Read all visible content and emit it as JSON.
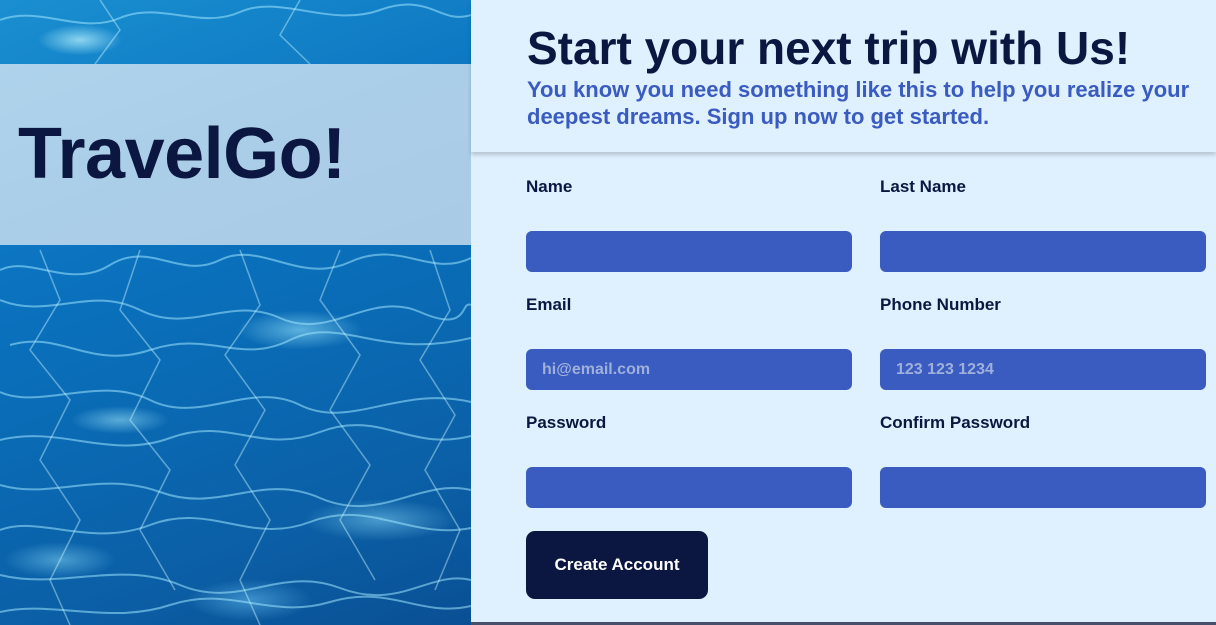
{
  "hero": {
    "brand": "TravelGo!"
  },
  "header": {
    "title": "Start your next trip with Us!",
    "subtitle": "You know you need something like this to help you realize your deepest dreams. Sign up now to get started."
  },
  "form": {
    "name": {
      "label": "Name",
      "value": "",
      "placeholder": ""
    },
    "last_name": {
      "label": "Last Name",
      "value": "",
      "placeholder": ""
    },
    "email": {
      "label": "Email",
      "value": "",
      "placeholder": "hi@email.com"
    },
    "phone": {
      "label": "Phone Number",
      "value": "",
      "placeholder": "123 123 1234"
    },
    "password": {
      "label": "Password",
      "value": "",
      "placeholder": ""
    },
    "confirm_password": {
      "label": "Confirm Password",
      "value": "",
      "placeholder": ""
    },
    "submit_label": "Create Account"
  },
  "colors": {
    "navy": "#0b1740",
    "accent_blue": "#3a5bbf",
    "panel_bg": "#dff0fe"
  }
}
